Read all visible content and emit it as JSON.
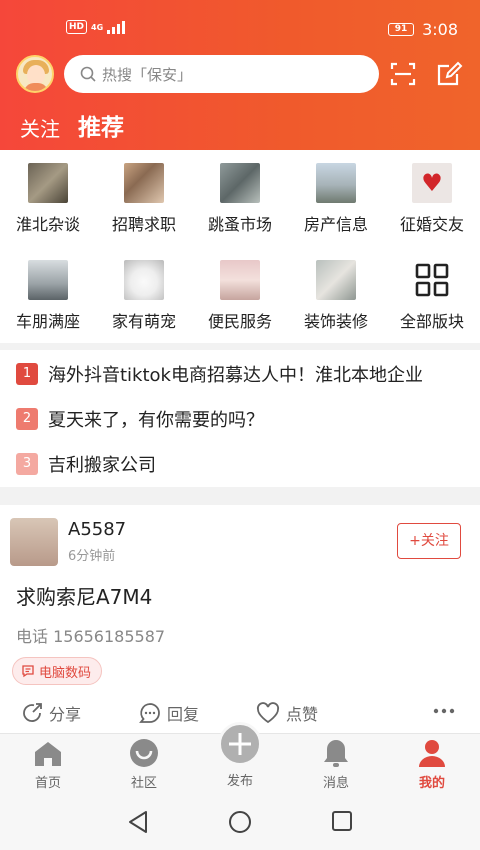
{
  "status_bar": {
    "network": "HD",
    "network_type": "4G",
    "battery": "91",
    "time": "3:08"
  },
  "header": {
    "search_placeholder": "热搜「保安」",
    "tabs": [
      {
        "label": "关注",
        "active": false
      },
      {
        "label": "推荐",
        "active": true
      }
    ],
    "accent_color": "#f5473a"
  },
  "categories": [
    {
      "label": "淮北杂谈",
      "icon": "street-photo"
    },
    {
      "label": "招聘求职",
      "icon": "crowd-photo"
    },
    {
      "label": "跳蚤市场",
      "icon": "market-photo"
    },
    {
      "label": "房产信息",
      "icon": "buildings-photo"
    },
    {
      "label": "征婚交友",
      "icon": "heart-photo"
    },
    {
      "label": "车朋满座",
      "icon": "car-photo"
    },
    {
      "label": "家有萌宠",
      "icon": "dog-photo"
    },
    {
      "label": "便民服务",
      "icon": "staff-photo"
    },
    {
      "label": "装饰装修",
      "icon": "interior-photo"
    },
    {
      "label": "全部版块",
      "icon": "grid-icon"
    }
  ],
  "hot_list": [
    {
      "rank": "1",
      "text": "海外抖音tiktok电商招募达人中！淮北本地企业",
      "color": "#e04a3f"
    },
    {
      "rank": "2",
      "text": "夏天来了，有你需要的吗？",
      "color": "#ee7b6f"
    },
    {
      "rank": "3",
      "text": "吉利搬家公司",
      "color": "#f4a9a1"
    }
  ],
  "post": {
    "user": "A5587",
    "time": "6分钟前",
    "follow_label": "+关注",
    "title": "求购索尼A7M4",
    "phone": "电话 15656185587",
    "tag": "电脑数码",
    "actions": {
      "share": "分享",
      "reply": "回复",
      "like": "点赞"
    }
  },
  "tabbar": [
    {
      "label": "首页",
      "icon": "home-icon",
      "active": false
    },
    {
      "label": "社区",
      "icon": "community-icon",
      "active": false
    },
    {
      "label": "发布",
      "icon": "plus-icon",
      "active": false
    },
    {
      "label": "消息",
      "icon": "bell-icon",
      "active": false
    },
    {
      "label": "我的",
      "icon": "user-icon",
      "active": true
    }
  ]
}
